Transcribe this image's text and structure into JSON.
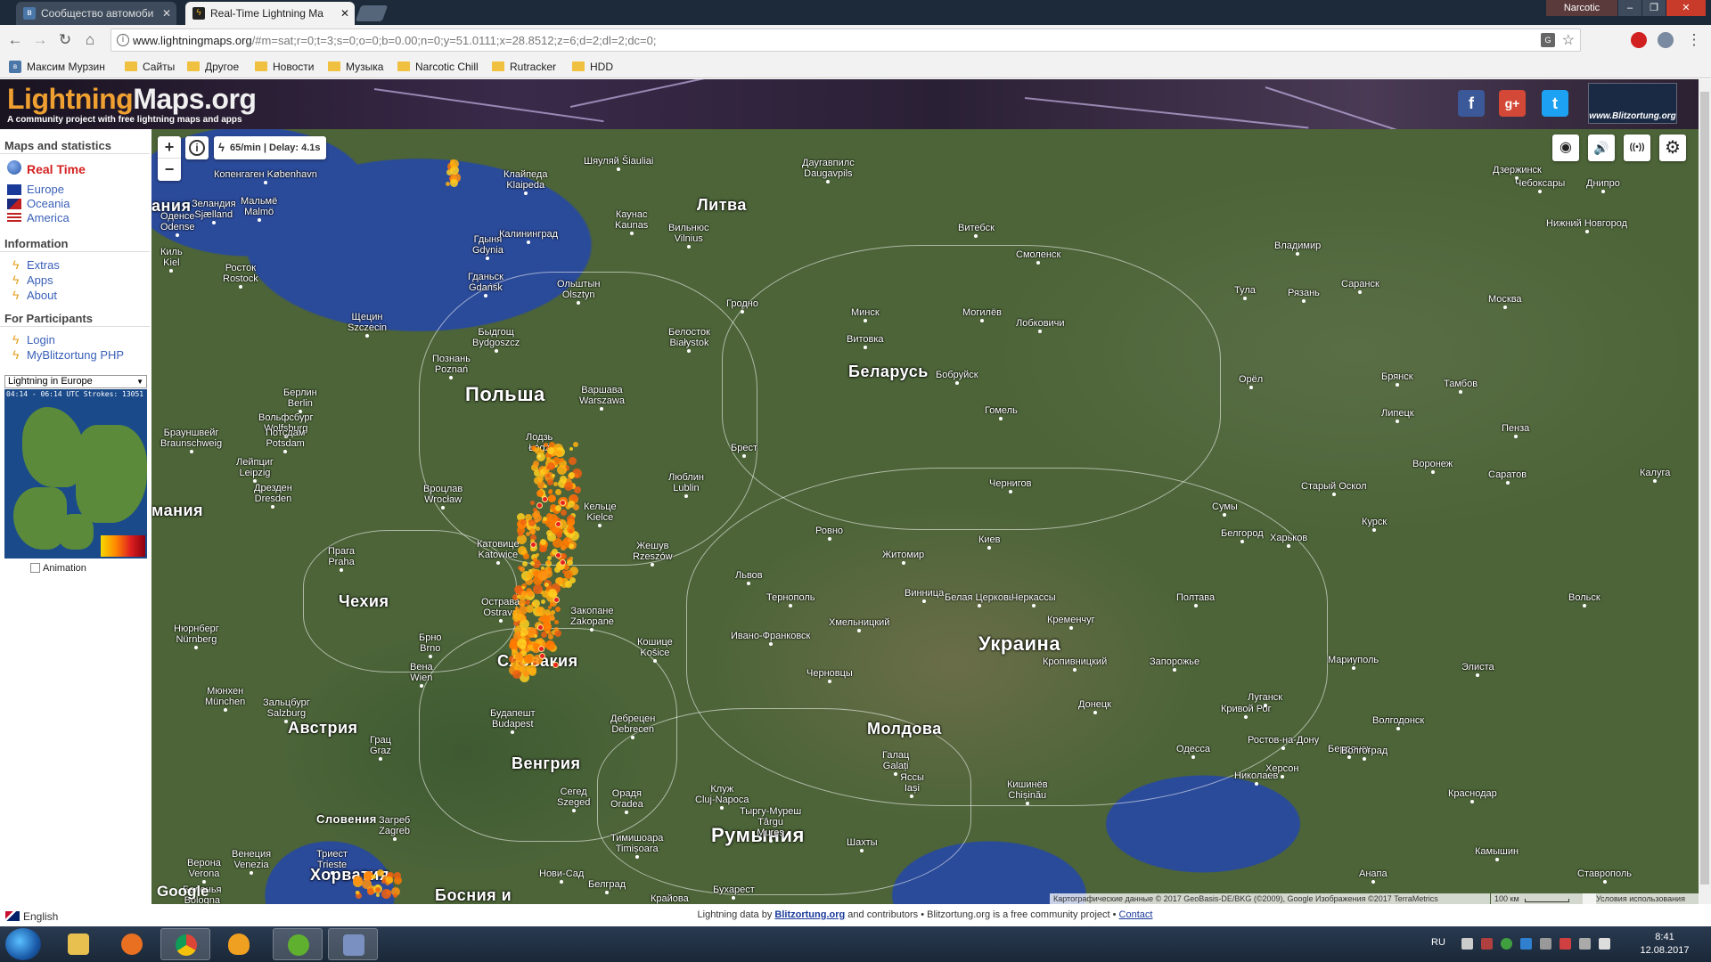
{
  "browser": {
    "tabs": [
      {
        "title": "Сообщество автомоби",
        "active": false
      },
      {
        "title": "Real-Time Lightning Ma",
        "active": true
      }
    ],
    "profile_name": "Narcotic",
    "url_host": "www.lightningmaps.org",
    "url_rest": "/#m=sat;r=0;t=3;s=0;o=0;b=0.00;n=0;y=51.0111;x=28.8512;z=6;d=2;dl=2;dc=0;",
    "bookmarks": [
      "Максим Мурзин",
      "Сайты",
      "Другое",
      "Новости",
      "Музыка",
      "Narcotic Chill",
      "Rutracker",
      "HDD"
    ]
  },
  "header": {
    "logo_part1": "Lightning",
    "logo_part2": "Maps.org",
    "tagline": "A community project with free lightning maps and apps",
    "blitz_logo_text": "www.Blitzortung.org",
    "social": [
      {
        "name": "facebook",
        "glyph": "f",
        "color": "#3b5998"
      },
      {
        "name": "google-plus",
        "glyph": "g+",
        "color": "#d34836"
      },
      {
        "name": "twitter",
        "glyph": "t",
        "color": "#1da1f2"
      }
    ]
  },
  "sidebar": {
    "maps_heading": "Maps and statistics",
    "realtime": "Real Time",
    "regions": [
      "Europe",
      "Oceania",
      "America"
    ],
    "info_heading": "Information",
    "info_links": [
      "Extras",
      "Apps",
      "About"
    ],
    "participants_heading": "For Participants",
    "participant_links": [
      "Login",
      "MyBlitzortung PHP"
    ],
    "minimap_select": "Lightning in Europe",
    "minimap_stamp": "04:14 - 06:14 UTC Strokes: 13051",
    "animation_label": "Animation",
    "language": "English"
  },
  "map": {
    "rate": "65/min | Delay: 4.1s",
    "zoom_in": "+",
    "zoom_out": "−",
    "info_glyph": "i",
    "right_controls": [
      {
        "name": "locate-icon",
        "glyph": "◉"
      },
      {
        "name": "sound-icon",
        "glyph": "🔊"
      },
      {
        "name": "stations-icon",
        "glyph": "((•))"
      },
      {
        "name": "settings-icon",
        "glyph": "⚙"
      }
    ],
    "countries": [
      "Литва",
      "Польша",
      "Беларусь",
      "Украина",
      "Словакия",
      "Чехия",
      "Австрия",
      "Венгрия",
      "Молдова",
      "Румыния",
      "Хорватия",
      "Словения",
      "Босния и",
      "мания",
      "ания"
    ],
    "cities": [
      "Клайпеда Klaipeda",
      "Шяуляй Šiauliai",
      "Даугавпилс Daugavpils",
      "Копенгаген København",
      "Мальмё Malmö",
      "Зеландия Sjælland",
      "Оденсе Odense",
      "Киль Kiel",
      "Росток Rostock",
      "Гдыня Gdynia",
      "Гданьск Gdańsk",
      "Калининград",
      "Ольштын Olsztyn",
      "Каунас Kaunas",
      "Вильнюс Vilnius",
      "Гродно",
      "Щецин Szczecin",
      "Быдгощ Bydgoszcz",
      "Белосток Białystok",
      "Познань Poznań",
      "Варшава Warszawa",
      "Берлин Berlin",
      "Вольфсбург Wolfsburg",
      "Брауншвейг Braunschweig",
      "Потсдам Potsdam",
      "Лодзь Łódź",
      "Лейпциг Leipzig",
      "Дрезден Dresden",
      "Вроцлав Wrocław",
      "Кельце Kielce",
      "Люблин Lublin",
      "Брест",
      "Катовице Katowice",
      "Жешув Rzeszów",
      "Прага Praha",
      "Острава Ostrava",
      "Закопане Zakopane",
      "Кошице Košice",
      "Брно Brno",
      "Нюрнберг Nürnberg",
      "Вена Wien",
      "Мюнхен München",
      "Зальцбург Salzburg",
      "Будапешт Budapest",
      "Дебрецен Debrecen",
      "Грац Graz",
      "Сегед Szeged",
      "Орадя Oradea",
      "Клуж Cluj-Napoca",
      "Тыргу-Муреш Târgu Mureș",
      "Тимишоара Timișoara",
      "Загреб Zagreb",
      "Триест Trieste",
      "Венеция Venezia",
      "Верона Verona",
      "Болонья Bologna",
      "Нови-Сад",
      "Белград",
      "Крайова",
      "Бухарест",
      "Витебск",
      "Смоленск",
      "Минск",
      "Могилёв",
      "Бобруйск",
      "Гомель",
      "Витовка",
      "Лобковичи",
      "Чернигов",
      "Ровно",
      "Житомир",
      "Киев",
      "Львов",
      "Тернополь",
      "Хмельницкий",
      "Винница",
      "Белая Церковь",
      "Черкассы",
      "Ивано-Франковск",
      "Черновцы",
      "Кременчуг",
      "Кропивницкий",
      "Полтава",
      "Сумы",
      "Харьков",
      "Белгород",
      "Курск",
      "Старый Оскол",
      "Воронеж",
      "Брянск",
      "Орёл",
      "Липецк",
      "Тамбов",
      "Пенза",
      "Саратов",
      "Калуга",
      "Тула",
      "Рязань",
      "Саранск",
      "Москва",
      "Владимир",
      "Нижний Новгород",
      "Дзержинск",
      "Чебоксары",
      "Днипро",
      "Запорожье",
      "Кривой Рог",
      "Донецк",
      "Луганск",
      "Мариуполь",
      "Ростов-на-Дону",
      "Бердянск",
      "Херсон",
      "Николаев",
      "Одесса",
      "Кишинёв Chișinău",
      "Яссы Iași",
      "Галац Galați",
      "Шахты",
      "Волгодонск",
      "Волгоград",
      "Элиста",
      "Краснодар",
      "Ставрополь",
      "Анапа",
      "Камышин",
      "Вольск"
    ],
    "google_label": "Google",
    "attribution": "Картографические данные © 2017 GeoBasis-DE/BKG (©2009), Google Изображения ©2017 TerraMetrics",
    "scale_label": "100 км",
    "terms": "Условия использования"
  },
  "footer": {
    "prefix": "Lightning data by",
    "blitz_link": "Blitzortung.org",
    "middle": "and contributors • Blitzortung.org is a free community project •",
    "contact": "Contact"
  },
  "taskbar": {
    "lang": "RU",
    "time": "8:41",
    "date": "12.08.2017"
  }
}
